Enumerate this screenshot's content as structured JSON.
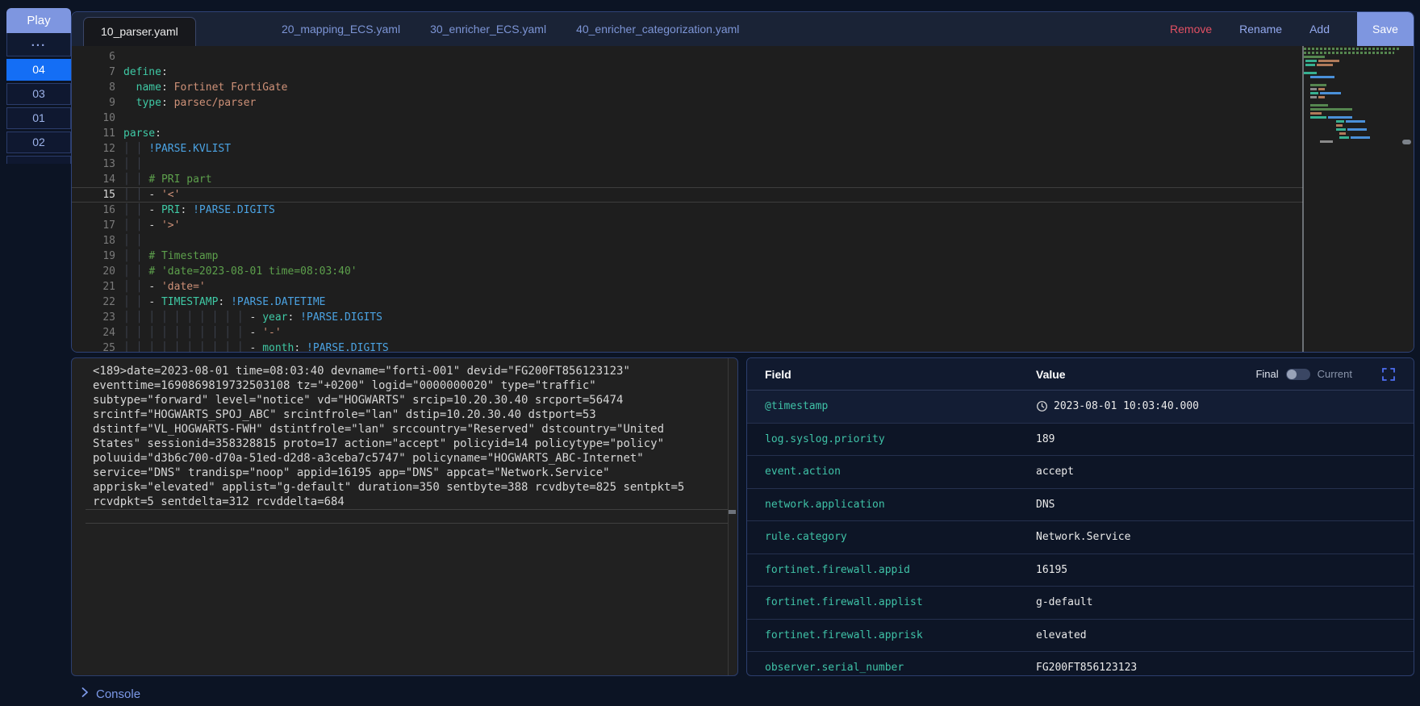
{
  "sidebar": {
    "play_label": "Play",
    "menu_label": "...",
    "samples": [
      {
        "label": "04",
        "active": true
      },
      {
        "label": "03",
        "active": false
      },
      {
        "label": "01",
        "active": false
      },
      {
        "label": "02",
        "active": false
      }
    ]
  },
  "tabs": {
    "items": [
      {
        "label": "10_parser.yaml",
        "active": true
      },
      {
        "label": "20_mapping_ECS.yaml",
        "active": false
      },
      {
        "label": "30_enricher_ECS.yaml",
        "active": false
      },
      {
        "label": "40_enricher_categorization.yaml",
        "active": false
      }
    ],
    "actions": {
      "remove": "Remove",
      "rename": "Rename",
      "add": "Add",
      "save": "Save"
    }
  },
  "editor": {
    "current_line": 15,
    "lines": [
      {
        "num": 6,
        "tokens": []
      },
      {
        "num": 7,
        "tokens": [
          [
            "k",
            "define"
          ],
          [
            "p",
            ":"
          ]
        ]
      },
      {
        "num": 8,
        "tokens": [
          [
            "p",
            "  "
          ],
          [
            "k",
            "name"
          ],
          [
            "p",
            ": "
          ],
          [
            "s",
            "Fortinet FortiGate"
          ]
        ]
      },
      {
        "num": 9,
        "tokens": [
          [
            "p",
            "  "
          ],
          [
            "k",
            "type"
          ],
          [
            "p",
            ": "
          ],
          [
            "s",
            "parsec/parser"
          ]
        ]
      },
      {
        "num": 10,
        "tokens": []
      },
      {
        "num": 11,
        "tokens": [
          [
            "k",
            "parse"
          ],
          [
            "p",
            ":"
          ]
        ]
      },
      {
        "num": 12,
        "tokens": [
          [
            "g",
            "│ │ "
          ],
          [
            "t",
            "!PARSE.KVLIST"
          ]
        ]
      },
      {
        "num": 13,
        "tokens": [
          [
            "g",
            "│ │ "
          ]
        ]
      },
      {
        "num": 14,
        "tokens": [
          [
            "g",
            "│ │ "
          ],
          [
            "c",
            "# PRI part"
          ]
        ]
      },
      {
        "num": 15,
        "tokens": [
          [
            "g",
            "│ │ "
          ],
          [
            "p",
            "- "
          ],
          [
            "s",
            "'<'"
          ]
        ]
      },
      {
        "num": 16,
        "tokens": [
          [
            "g",
            "│ │ "
          ],
          [
            "p",
            "- "
          ],
          [
            "k",
            "PRI"
          ],
          [
            "p",
            ": "
          ],
          [
            "t",
            "!PARSE.DIGITS"
          ]
        ]
      },
      {
        "num": 17,
        "tokens": [
          [
            "g",
            "│ │ "
          ],
          [
            "p",
            "- "
          ],
          [
            "s",
            "'>'"
          ]
        ]
      },
      {
        "num": 18,
        "tokens": [
          [
            "g",
            "│ │ "
          ]
        ]
      },
      {
        "num": 19,
        "tokens": [
          [
            "g",
            "│ │ "
          ],
          [
            "c",
            "# Timestamp"
          ]
        ]
      },
      {
        "num": 20,
        "tokens": [
          [
            "g",
            "│ │ "
          ],
          [
            "c",
            "# 'date=2023-08-01 time=08:03:40'"
          ]
        ]
      },
      {
        "num": 21,
        "tokens": [
          [
            "g",
            "│ │ "
          ],
          [
            "p",
            "- "
          ],
          [
            "s",
            "'date='"
          ]
        ]
      },
      {
        "num": 22,
        "tokens": [
          [
            "g",
            "│ │ "
          ],
          [
            "p",
            "- "
          ],
          [
            "k",
            "TIMESTAMP"
          ],
          [
            "p",
            ": "
          ],
          [
            "t",
            "!PARSE.DATETIME"
          ]
        ]
      },
      {
        "num": 23,
        "tokens": [
          [
            "g",
            "│ │ │ │ │ │ │ │ │ │ "
          ],
          [
            "p",
            "- "
          ],
          [
            "k",
            "year"
          ],
          [
            "p",
            ": "
          ],
          [
            "t",
            "!PARSE.DIGITS"
          ]
        ]
      },
      {
        "num": 24,
        "tokens": [
          [
            "g",
            "│ │ │ │ │ │ │ │ │ │ "
          ],
          [
            "p",
            "- "
          ],
          [
            "s",
            "'-'"
          ]
        ]
      },
      {
        "num": 25,
        "tokens": [
          [
            "g",
            "│ │ │ │ │ │ │ │ │ │ "
          ],
          [
            "p",
            "- "
          ],
          [
            "k",
            "month"
          ],
          [
            "p",
            ": "
          ],
          [
            "t",
            "!PARSE.DIGITS"
          ]
        ]
      }
    ]
  },
  "log_input": {
    "text": "<189>date=2023-08-01 time=08:03:40 devname=\"forti-001\" devid=\"FG200FT856123123\" eventtime=1690869819732503108 tz=\"+0200\" logid=\"0000000020\" type=\"traffic\" subtype=\"forward\" level=\"notice\" vd=\"HOGWARTS\" srcip=10.20.30.40 srcport=56474 srcintf=\"HOGWARTS_SPOJ_ABC\" srcintfrole=\"lan\" dstip=10.20.30.40 dstport=53 dstintf=\"VL_HOGWARTS-FWH\" dstintfrole=\"lan\" srccountry=\"Reserved\" dstcountry=\"United States\" sessionid=358328815 proto=17 action=\"accept\" policyid=14 policytype=\"policy\" poluuid=\"d3b6c700-d70a-51ed-d2d8-a3ceba7c5747\" policyname=\"HOGWARTS_ABC-Internet\" service=\"DNS\" trandisp=\"noop\" appid=16195 app=\"DNS\" appcat=\"Network.Service\" apprisk=\"elevated\" applist=\"g-default\" duration=350 sentbyte=388 rcvdbyte=825 sentpkt=5 rcvdpkt=5 sentdelta=312 rcvddelta=684"
  },
  "fields_panel": {
    "columns": {
      "field": "Field",
      "value": "Value"
    },
    "mode_toggle": {
      "left_label": "Final",
      "right_label": "Current",
      "selected": "Final"
    },
    "icons": {
      "timestamp": "clock-icon",
      "expand": "expand-icon"
    },
    "rows": [
      {
        "field": "@timestamp",
        "value": "2023-08-01 10:03:40.000",
        "icon": "clock"
      },
      {
        "field": "log.syslog.priority",
        "value": "189"
      },
      {
        "field": "event.action",
        "value": "accept"
      },
      {
        "field": "network.application",
        "value": "DNS"
      },
      {
        "field": "rule.category",
        "value": "Network.Service"
      },
      {
        "field": "fortinet.firewall.appid",
        "value": "16195"
      },
      {
        "field": "fortinet.firewall.applist",
        "value": "g-default"
      },
      {
        "field": "fortinet.firewall.apprisk",
        "value": "elevated"
      },
      {
        "field": "observer.serial_number",
        "value": "FG200FT856123123"
      }
    ]
  },
  "console": {
    "label": "Console",
    "icon": "chevron-right-icon"
  },
  "colors": {
    "accent_blue": "#146ef5",
    "periwinkle": "#7e96e0",
    "remove_red": "#e25063",
    "link_blue": "#93a9ee",
    "field_teal": "#3fc2a7",
    "code_key_teal": "#3fc9a5",
    "code_tag_blue": "#4ba3e3",
    "code_string_orange": "#ce9178",
    "code_comment_green": "#5da04c"
  }
}
